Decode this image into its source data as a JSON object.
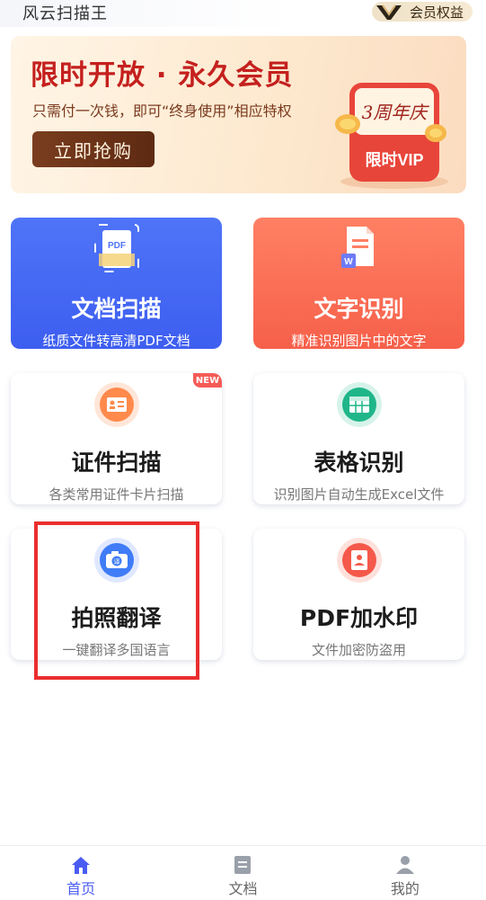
{
  "app": {
    "title": "风云扫描王",
    "vip_label": "会员权益"
  },
  "banner": {
    "title": "限时开放 · 永久会员",
    "subtitle": "只需付一次钱，即可“终身使用”相应特权",
    "button": "立即抢购",
    "art_top": "3周年庆",
    "art_bottom": "限时VIP"
  },
  "tiles": [
    {
      "title": "文档扫描",
      "subtitle": "纸质文件转高清PDF文档",
      "icon": "pdf-scan-icon",
      "style": "blue"
    },
    {
      "title": "文字识别",
      "subtitle": "精准识别图片中的文字",
      "icon": "word-doc-icon",
      "style": "red"
    },
    {
      "title": "证件扫描",
      "subtitle": "各类常用证件卡片扫描",
      "icon": "id-card-icon",
      "badge": "NEW"
    },
    {
      "title": "表格识别",
      "subtitle": "识别图片自动生成Excel文件",
      "icon": "table-icon"
    },
    {
      "title": "拍照翻译",
      "subtitle": "一键翻译多国语言",
      "icon": "camera-translate-icon"
    },
    {
      "title": "PDF加水印",
      "subtitle": "文件加密防盗用",
      "icon": "watermark-icon"
    }
  ],
  "pdf_icon_label": "PDF",
  "word_icon_label": "W",
  "translate_glyph": "译",
  "nav": [
    {
      "label": "首页",
      "icon": "home-icon",
      "active": true
    },
    {
      "label": "文档",
      "icon": "document-icon",
      "active": false
    },
    {
      "label": "我的",
      "icon": "profile-icon",
      "active": false
    }
  ],
  "colors": {
    "accent": "#4a5cf2",
    "highlight": "#ea2e2e",
    "banner_title": "#c4201e"
  }
}
